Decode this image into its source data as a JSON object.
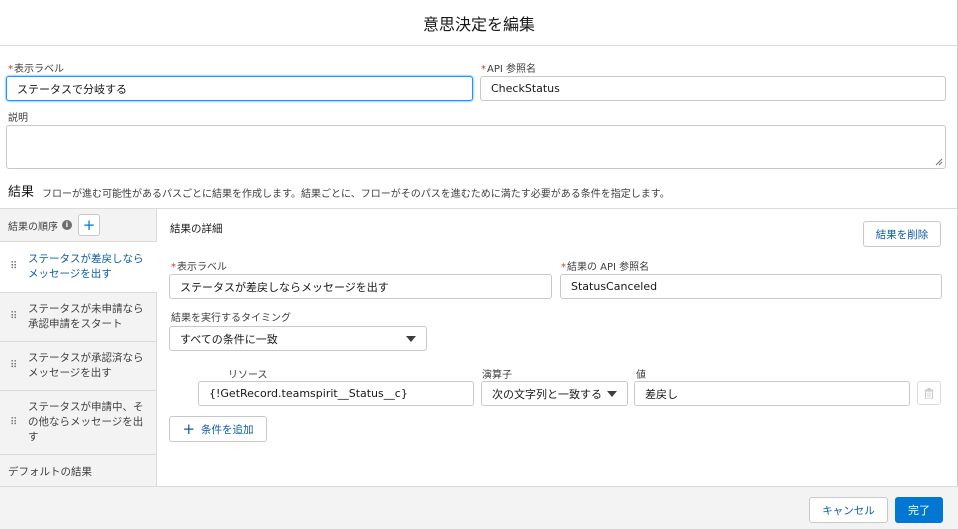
{
  "modal": {
    "title": "意思決定を編集"
  },
  "form": {
    "label_field": {
      "label": "表示ラベル",
      "value": "ステータスで分岐する"
    },
    "api_field": {
      "label": "API 参照名",
      "value": "CheckStatus"
    },
    "description": {
      "label": "説明",
      "value": ""
    }
  },
  "outcomes_section": {
    "title": "結果",
    "description": "フローが進む可能性があるパスごとに結果を作成します。結果ごとに、フローがそのパスを進むために満たす必要がある条件を指定します。"
  },
  "sidebar": {
    "header": "結果の順序",
    "items": [
      {
        "label": "ステータスが差戻しならメッセージを出す"
      },
      {
        "label": "ステータスが未申請なら承認申請をスタート"
      },
      {
        "label": "ステータスが承認済ならメッセージを出す"
      },
      {
        "label": "ステータスが申請中、その他ならメッセージを出す"
      }
    ],
    "default_item": "デフォルトの結果"
  },
  "detail": {
    "title": "結果の詳細",
    "delete_button": "結果を削除",
    "label_field": {
      "label": "表示ラベル",
      "value": "ステータスが差戻しならメッセージを出す"
    },
    "api_field": {
      "label": "結果の API 参照名",
      "value": "StatusCanceled"
    },
    "timing": {
      "label": "結果を実行するタイミング",
      "value": "すべての条件に一致"
    },
    "condition": {
      "resource_label": "リソース",
      "resource_value": "{!GetRecord.teamspirit__Status__c}",
      "operator_label": "演算子",
      "operator_value": "次の文字列と一致する",
      "value_label": "値",
      "value_value": "差戻し"
    },
    "add_condition_button": "条件を追加"
  },
  "footer": {
    "cancel_button": "キャンセル",
    "done_button": "完了"
  },
  "colors": {
    "brand": "#0176d3",
    "link": "#0b5cab",
    "required": "#c23934"
  }
}
